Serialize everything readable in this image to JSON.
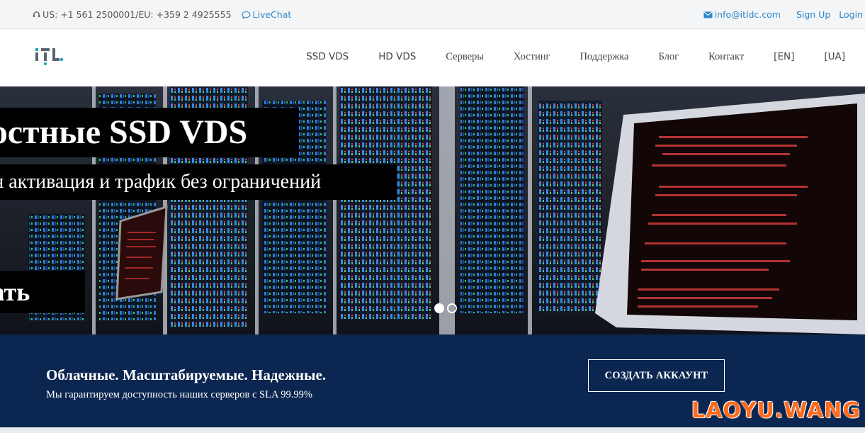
{
  "topbar": {
    "phone": "US: +1 561 2500001/EU: +359 2 4925555",
    "livechat": "LiveChat",
    "email": "info@itldc.com",
    "signup": "Sign Up",
    "login": "Login"
  },
  "nav": {
    "items": [
      "SSD VDS",
      "HD VDS",
      "Серверы",
      "Хостинг",
      "Поддержка",
      "Блог",
      "Контакт",
      "[EN]",
      "[UA]"
    ]
  },
  "hero": {
    "title": "ростные SSD VDS",
    "subtitle": "нная активация и трафик без ограничений",
    "button": "азать",
    "slides": 2,
    "active_slide": 1
  },
  "banner": {
    "heading": "Облачные. Масштабируемые. Надежные.",
    "text": "Мы гарантируем доступность наших серверов с SLA 99.99%",
    "cta": "СОЗДАТЬ АККАУНТ"
  },
  "watermark": "LAOYU.WANG",
  "colors": {
    "link": "#2d86c9",
    "banner_bg": "#0b2650",
    "logo_accent": "#1aa3c2",
    "watermark": "#ff6a1a"
  }
}
